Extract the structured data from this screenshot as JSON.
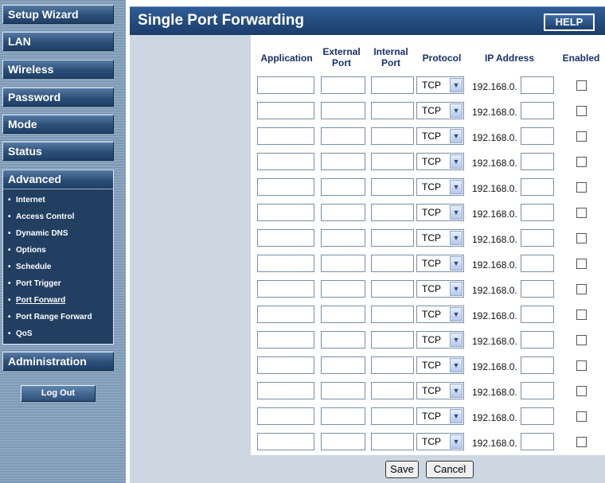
{
  "sidebar": {
    "items": [
      {
        "label": "Setup Wizard"
      },
      {
        "label": "LAN"
      },
      {
        "label": "Wireless"
      },
      {
        "label": "Password"
      },
      {
        "label": "Mode"
      },
      {
        "label": "Status"
      }
    ],
    "advanced": {
      "label": "Advanced",
      "subitems": [
        {
          "label": "Internet"
        },
        {
          "label": "Access Control"
        },
        {
          "label": "Dynamic DNS"
        },
        {
          "label": "Options"
        },
        {
          "label": "Schedule"
        },
        {
          "label": "Port Trigger"
        },
        {
          "label": "Port Forward",
          "active": true
        },
        {
          "label": "Port Range Forward"
        },
        {
          "label": "QoS"
        }
      ]
    },
    "administration": {
      "label": "Administration"
    },
    "logout": {
      "label": "Log Out"
    }
  },
  "header": {
    "title": "Single Port Forwarding",
    "help_label": "HELP"
  },
  "table": {
    "columns": {
      "application": "Application",
      "external_port_1": "External",
      "external_port_2": "Port",
      "internal_port_1": "Internal",
      "internal_port_2": "Port",
      "protocol": "Protocol",
      "ip_address": "IP Address",
      "enabled": "Enabled"
    },
    "rows": [
      {
        "application": "",
        "external_port": "",
        "internal_port": "",
        "protocol": "TCP",
        "ip_prefix": "192.168.0.",
        "ip_last": "",
        "enabled": false
      },
      {
        "application": "",
        "external_port": "",
        "internal_port": "",
        "protocol": "TCP",
        "ip_prefix": "192.168.0.",
        "ip_last": "",
        "enabled": false
      },
      {
        "application": "",
        "external_port": "",
        "internal_port": "",
        "protocol": "TCP",
        "ip_prefix": "192.168.0.",
        "ip_last": "",
        "enabled": false
      },
      {
        "application": "",
        "external_port": "",
        "internal_port": "",
        "protocol": "TCP",
        "ip_prefix": "192.168.0.",
        "ip_last": "",
        "enabled": false
      },
      {
        "application": "",
        "external_port": "",
        "internal_port": "",
        "protocol": "TCP",
        "ip_prefix": "192.168.0.",
        "ip_last": "",
        "enabled": false
      },
      {
        "application": "",
        "external_port": "",
        "internal_port": "",
        "protocol": "TCP",
        "ip_prefix": "192.168.0.",
        "ip_last": "",
        "enabled": false
      },
      {
        "application": "",
        "external_port": "",
        "internal_port": "",
        "protocol": "TCP",
        "ip_prefix": "192.168.0.",
        "ip_last": "",
        "enabled": false
      },
      {
        "application": "",
        "external_port": "",
        "internal_port": "",
        "protocol": "TCP",
        "ip_prefix": "192.168.0.",
        "ip_last": "",
        "enabled": false
      },
      {
        "application": "",
        "external_port": "",
        "internal_port": "",
        "protocol": "TCP",
        "ip_prefix": "192.168.0.",
        "ip_last": "",
        "enabled": false
      },
      {
        "application": "",
        "external_port": "",
        "internal_port": "",
        "protocol": "TCP",
        "ip_prefix": "192.168.0.",
        "ip_last": "",
        "enabled": false
      },
      {
        "application": "",
        "external_port": "",
        "internal_port": "",
        "protocol": "TCP",
        "ip_prefix": "192.168.0.",
        "ip_last": "",
        "enabled": false
      },
      {
        "application": "",
        "external_port": "",
        "internal_port": "",
        "protocol": "TCP",
        "ip_prefix": "192.168.0.",
        "ip_last": "",
        "enabled": false
      },
      {
        "application": "",
        "external_port": "",
        "internal_port": "",
        "protocol": "TCP",
        "ip_prefix": "192.168.0.",
        "ip_last": "",
        "enabled": false
      },
      {
        "application": "",
        "external_port": "",
        "internal_port": "",
        "protocol": "TCP",
        "ip_prefix": "192.168.0.",
        "ip_last": "",
        "enabled": false
      },
      {
        "application": "",
        "external_port": "",
        "internal_port": "",
        "protocol": "TCP",
        "ip_prefix": "192.168.0.",
        "ip_last": "",
        "enabled": false
      }
    ]
  },
  "footer": {
    "save_label": "Save",
    "cancel_label": "Cancel"
  },
  "icons": {
    "dropdown": "chevron-down-icon",
    "bullet": "bullet-icon"
  }
}
